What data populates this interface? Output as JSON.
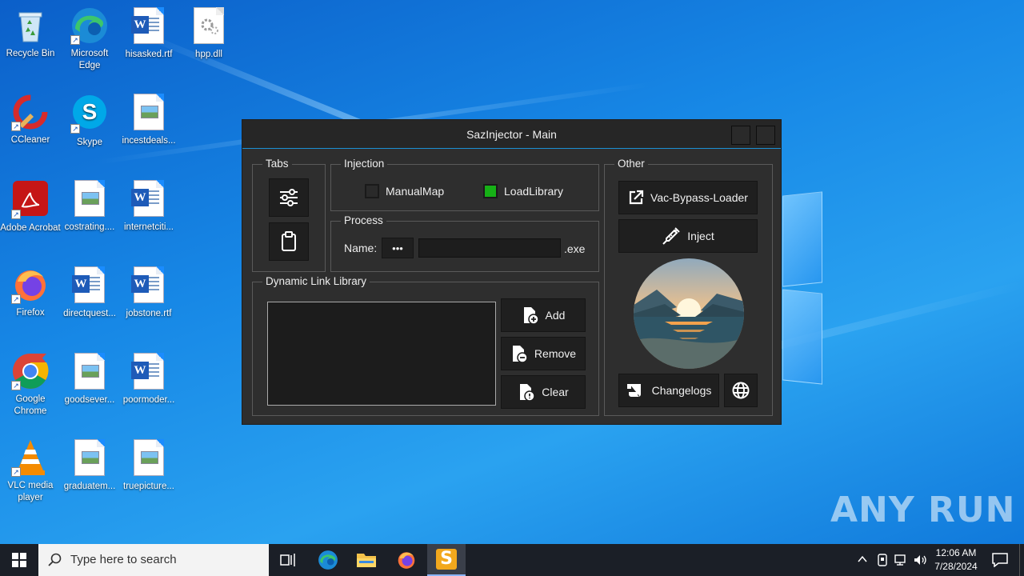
{
  "desktop": {
    "icons": [
      {
        "label": "Recycle Bin"
      },
      {
        "label": "Microsoft Edge"
      },
      {
        "label": "hisasked.rtf"
      },
      {
        "label": "hpp.dll"
      },
      {
        "label": "CCleaner"
      },
      {
        "label": "Skype"
      },
      {
        "label": "incestdeals..."
      },
      {
        "label": "Adobe Acrobat"
      },
      {
        "label": "costrating...."
      },
      {
        "label": "internetciti..."
      },
      {
        "label": "Firefox"
      },
      {
        "label": "directquest..."
      },
      {
        "label": "jobstone.rtf"
      },
      {
        "label": "Google Chrome"
      },
      {
        "label": "goodsever..."
      },
      {
        "label": "poormoder..."
      },
      {
        "label": "VLC media player"
      },
      {
        "label": "graduatem..."
      },
      {
        "label": "truepicture..."
      }
    ],
    "watermark": "ANY RUN"
  },
  "window": {
    "title": "SazInjector - Main",
    "tabs": {
      "legend": "Tabs",
      "buttons": [
        {
          "icon": "sliders-icon"
        },
        {
          "icon": "clipboard-icon"
        }
      ]
    },
    "injection": {
      "legend": "Injection",
      "options": [
        {
          "label": "ManualMap",
          "checked": false
        },
        {
          "label": "LoadLibrary",
          "checked": true
        }
      ],
      "checked_color": "#16b016"
    },
    "process": {
      "legend": "Process",
      "name_label": "Name:",
      "browse_label": "•••",
      "name_value": "",
      "suffix": ".exe"
    },
    "dll": {
      "legend": "Dynamic Link Library",
      "buttons": [
        {
          "label": "Add"
        },
        {
          "label": "Remove"
        },
        {
          "label": "Clear"
        }
      ]
    },
    "other": {
      "legend": "Other",
      "bypass_label": "Vac-Bypass-Loader",
      "inject_label": "Inject",
      "changelogs_label": "Changelogs"
    },
    "accent": "#1b8fd4"
  },
  "taskbar": {
    "search_placeholder": "Type here to search",
    "time": "12:06 AM",
    "date": "7/28/2024",
    "active_app_letter": "S"
  }
}
